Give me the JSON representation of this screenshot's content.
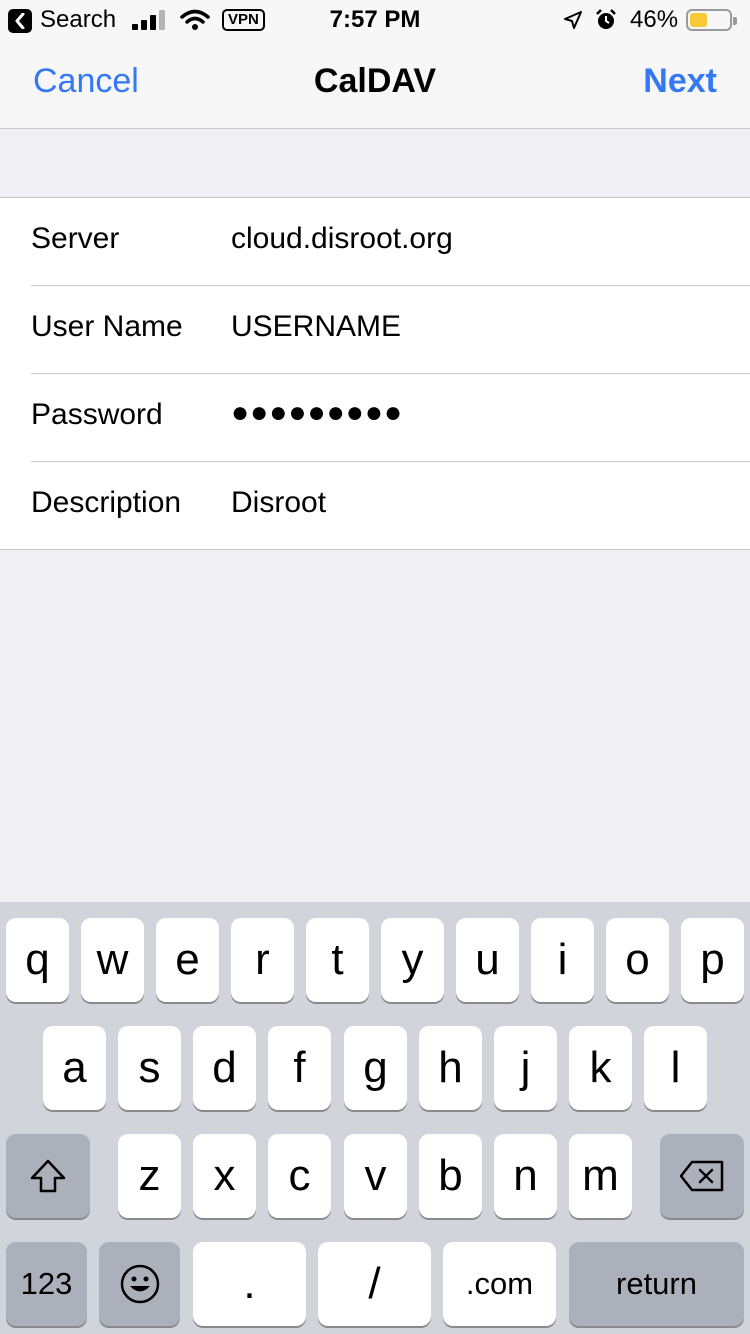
{
  "status_bar": {
    "back_label": "Search",
    "vpn": "VPN",
    "time": "7:57 PM",
    "battery_pct": "46%",
    "battery_level": 0.46,
    "battery_color": "#f8ca37"
  },
  "nav": {
    "cancel": "Cancel",
    "title": "CalDAV",
    "next": "Next",
    "accent": "#3478f6"
  },
  "form": [
    {
      "label": "Server",
      "value": "cloud.disroot.org"
    },
    {
      "label": "User Name",
      "value": "USERNAME"
    },
    {
      "label": "Password",
      "value": "●●●●●●●●●"
    },
    {
      "label": "Description",
      "value": "Disroot"
    }
  ],
  "keyboard": {
    "row1": [
      "q",
      "w",
      "e",
      "r",
      "t",
      "y",
      "u",
      "i",
      "o",
      "p"
    ],
    "row2": [
      "a",
      "s",
      "d",
      "f",
      "g",
      "h",
      "j",
      "k",
      "l"
    ],
    "row3": [
      "z",
      "x",
      "c",
      "v",
      "b",
      "n",
      "m"
    ],
    "numbers": "123",
    "dot": ".",
    "slash": "/",
    "dotcom": ".com",
    "return": "return"
  }
}
